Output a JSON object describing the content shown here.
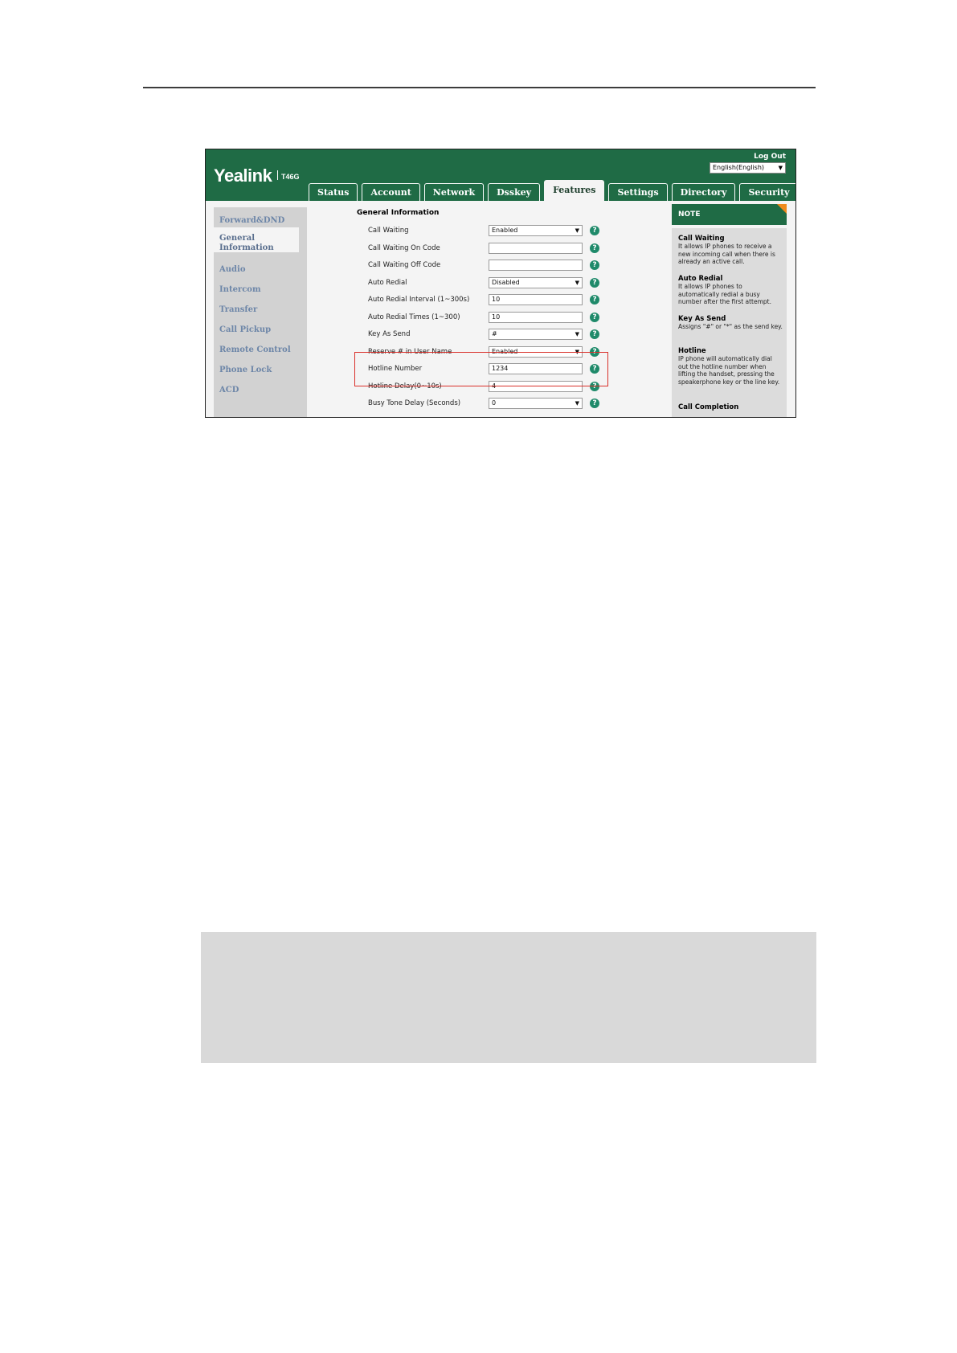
{
  "app": {
    "brand": "Yealink",
    "model": "T46G",
    "logout": "Log Out",
    "language": "English(English)"
  },
  "tabs": [
    "Status",
    "Account",
    "Network",
    "Dsskey",
    "Features",
    "Settings",
    "Directory",
    "Security"
  ],
  "active_tab": "Features",
  "sidebar": {
    "items": [
      "Forward&DND",
      "General Information",
      "Audio",
      "Intercom",
      "Transfer",
      "Call Pickup",
      "Remote Control",
      "Phone Lock",
      "ACD"
    ],
    "selected_line1": "General",
    "selected_line2": "Information"
  },
  "section_title": "General Information",
  "rows": [
    {
      "label": "Call Waiting",
      "value": "Enabled",
      "type": "select"
    },
    {
      "label": "Call Waiting On Code",
      "value": "",
      "type": "input"
    },
    {
      "label": "Call Waiting Off Code",
      "value": "",
      "type": "input"
    },
    {
      "label": "Auto Redial",
      "value": "Disabled",
      "type": "select"
    },
    {
      "label": "Auto Redial Interval (1~300s)",
      "value": "10",
      "type": "input"
    },
    {
      "label": "Auto Redial Times (1~300)",
      "value": "10",
      "type": "input"
    },
    {
      "label": "Key As Send",
      "value": "#",
      "type": "select"
    },
    {
      "label": "Reserve # in User Name",
      "value": "Enabled",
      "type": "select"
    },
    {
      "label": "Hotline Number",
      "value": "1234",
      "type": "input"
    },
    {
      "label": "Hotline Delay(0~10s)",
      "value": "4",
      "type": "input"
    },
    {
      "label": "Busy Tone Delay (Seconds)",
      "value": "0",
      "type": "select"
    }
  ],
  "help_glyph": "?",
  "arrow_glyph": "▼",
  "note": {
    "header": "NOTE",
    "entries": [
      {
        "title": "Call Waiting",
        "text": "It allows IP phones to receive a new incoming call when there is already an active call."
      },
      {
        "title": "Auto Redial",
        "text": "It allows IP phones to automatically redial a busy number after the first attempt."
      },
      {
        "title": "Key As Send",
        "text": "Assigns \"#\" or \"*\" as the send key."
      },
      {
        "title": "Hotline",
        "text": "IP phone will automatically dial out the hotline number when lifting the handset, pressing the speakerphone key or the line key."
      },
      {
        "title": "Call Completion",
        "text": ""
      }
    ]
  },
  "colors": {
    "brand_green": "#1f6b45",
    "highlight_red": "#d9302a",
    "note_corner": "#f08a1c",
    "help_teal": "#1f8a6a"
  }
}
